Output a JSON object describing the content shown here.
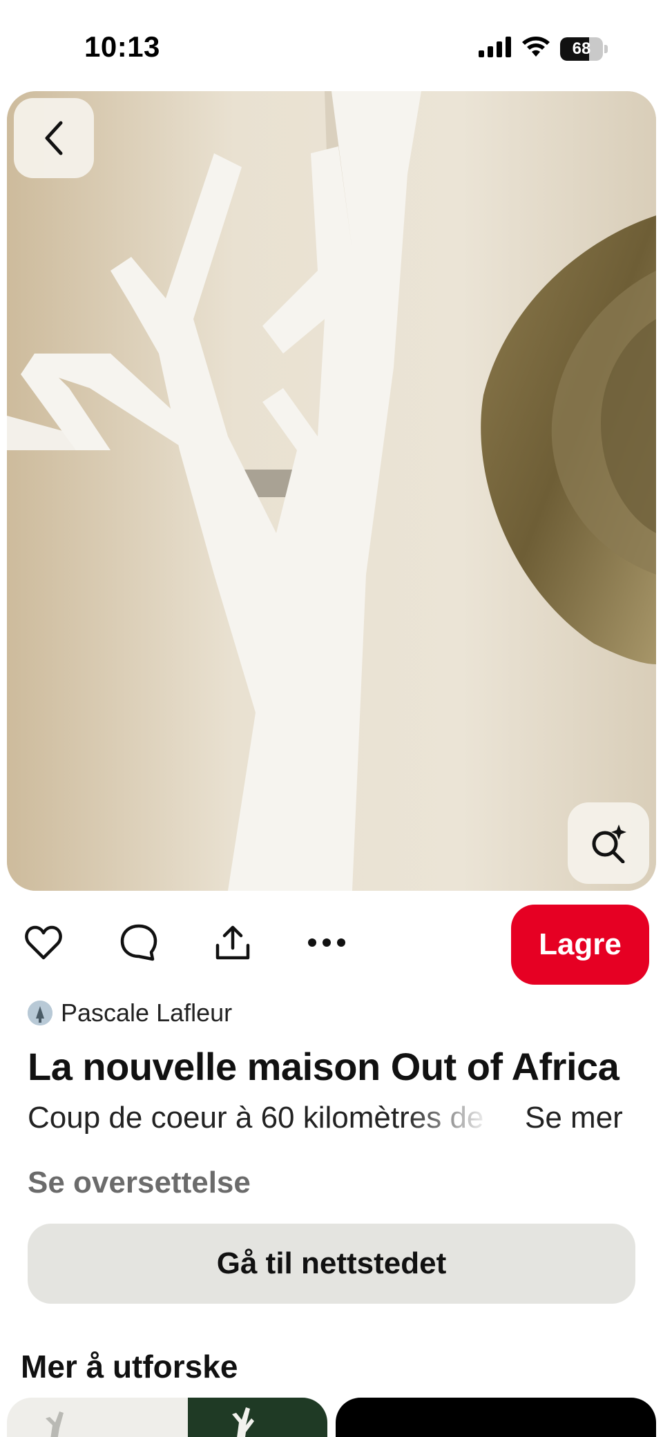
{
  "status_bar": {
    "time": "10:13",
    "battery_level": "68",
    "battery_fraction": 0.68
  },
  "pin": {
    "author": "Pascale Lafleur",
    "title": "La nouvelle maison Out of Africa",
    "description": "Coup de coeur à 60 kilomètres de",
    "see_more": "Se mer",
    "translate": "Se oversettelse",
    "visit_button": "Gå til nettstedet",
    "save_button": "Lagre"
  },
  "icons": {
    "back": "back-icon",
    "visual_search": "visual-search-icon",
    "like": "heart-icon",
    "comment": "comment-icon",
    "share": "share-icon",
    "more": "more-icon"
  },
  "colors": {
    "accent": "#e60023",
    "secondary_button": "#e4e4e0",
    "muted_text": "#6b6b6b"
  },
  "explore": {
    "title": "Mer å utforske"
  }
}
